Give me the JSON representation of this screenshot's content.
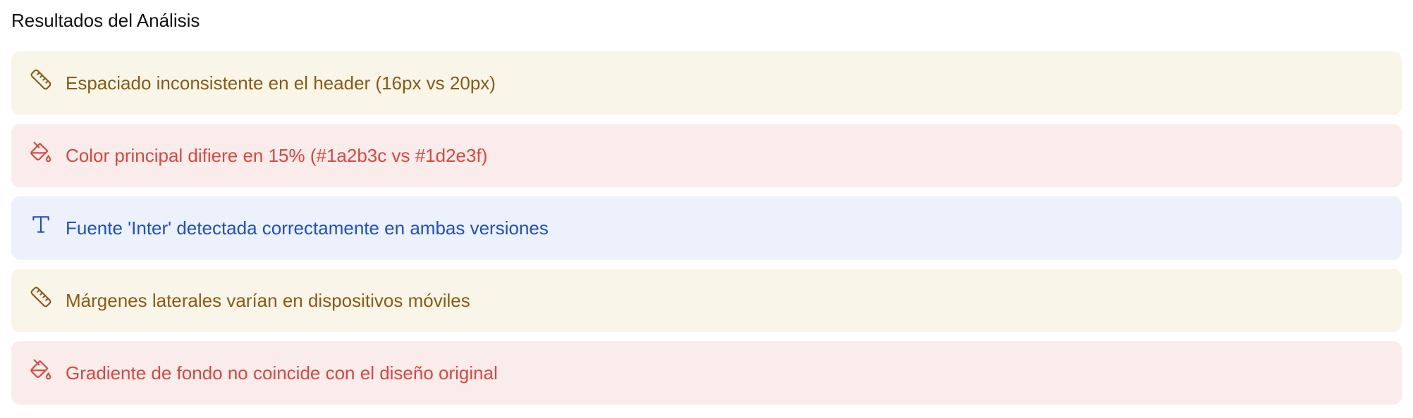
{
  "section": {
    "title": "Resultados del Análisis"
  },
  "results": [
    {
      "type": "warning",
      "icon": "ruler-icon",
      "text": "Espaciado inconsistente en el header (16px vs 20px)"
    },
    {
      "type": "error",
      "icon": "paint-bucket-icon",
      "text": "Color principal difiere en 15% (#1a2b3c vs #1d2e3f)"
    },
    {
      "type": "info",
      "icon": "type-icon",
      "text": "Fuente 'Inter' detectada correctamente en ambas versiones"
    },
    {
      "type": "warning",
      "icon": "ruler-icon",
      "text": "Márgenes laterales varían en dispositivos móviles"
    },
    {
      "type": "error",
      "icon": "paint-bucket-icon",
      "text": "Gradiente de fondo no coincide con el diseño original"
    }
  ],
  "colors": {
    "warning_bg": "#faf5e9",
    "warning_text": "#8a5a14",
    "error_bg": "#fbecec",
    "error_text": "#d9473f",
    "info_bg": "#ecf1fb",
    "info_text": "#1f4ec8"
  }
}
